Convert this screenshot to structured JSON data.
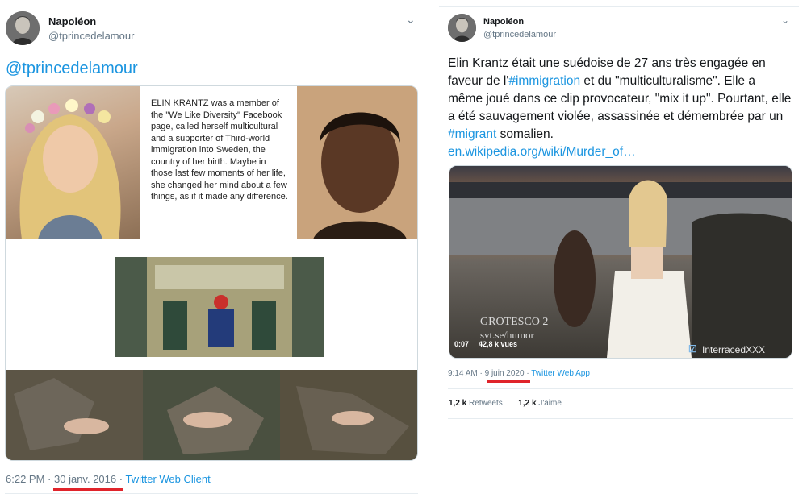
{
  "left_tweet": {
    "author_name": "Napoléon",
    "author_handle": "@tprincedelamour",
    "mention": "@tprincedelamour",
    "collage_text": "ELIN KRANTZ was a member of the \"We Like Diversity\" Facebook page, called herself multicultural and a supporter of Third-world immigration into Sweden, the country of her birth. Maybe in those last few moments of her life, she changed her mind about a few things, as if it made any difference.",
    "time": "6:22 PM",
    "date": "30 janv. 2016",
    "client": "Twitter Web Client",
    "sep": "·"
  },
  "right_tweet": {
    "author_name": "Napoléon",
    "author_handle": "@tprincedelamour",
    "text_1": "Elin Krantz était une suédoise de 27 ans très engagée en faveur de l'",
    "hashtag_1": "#immigration",
    "text_2": " et du \"multiculturalisme\". Elle a même joué dans ce clip provocateur, \"mix it up\". Pourtant, elle a été sauvagement violée, assassinée et démembrée par un ",
    "hashtag_2": "#migrant",
    "text_3": " somalien.",
    "url": "en.wikipedia.org/wiki/Murder_of…",
    "video_overlay_1": "GROTESCO 2",
    "video_overlay_2": "svt.se/humor",
    "video_duration": "0:07",
    "video_views": "42,8 k vues",
    "video_watermark": "InterracedXXX",
    "time": "9:14 AM",
    "date": "9 juin 2020",
    "client": "Twitter Web App",
    "sep": "·",
    "retweets_count": "1,2 k",
    "retweets_label": "Retweets",
    "likes_count": "1,2 k",
    "likes_label": "J'aime"
  },
  "colors": {
    "link": "#1b95e0",
    "meta": "#657786",
    "underline": "#e0242b",
    "divider": "#e6ecf0"
  }
}
